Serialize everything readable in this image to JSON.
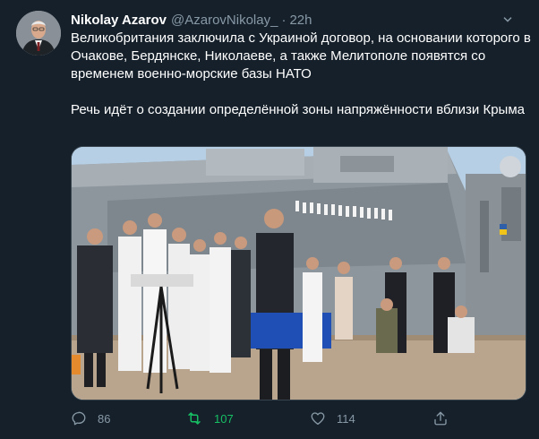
{
  "tweet": {
    "author_name": "Nikolay Azarov",
    "handle": "@AzarovNikolay_",
    "separator": "·",
    "time": "22h",
    "paragraph_1": "Великобритания заключила с Украиной договор, на основании которого в Очакове, Бердянске, Николаеве, а также Мелитополе появятся со временем военно-морские базы НАТО",
    "paragraph_2": "Речь идёт о создании определённой зоны напряжённости вблизи Крыма"
  },
  "actions": {
    "replies": "86",
    "retweets": "107",
    "likes": "114"
  },
  "colors": {
    "background": "#15202b",
    "secondary_text": "#8899a6",
    "retweet_active": "#17bf63"
  },
  "icons": [
    "more-options-icon",
    "reply-icon",
    "retweet-icon",
    "like-icon",
    "share-icon"
  ]
}
